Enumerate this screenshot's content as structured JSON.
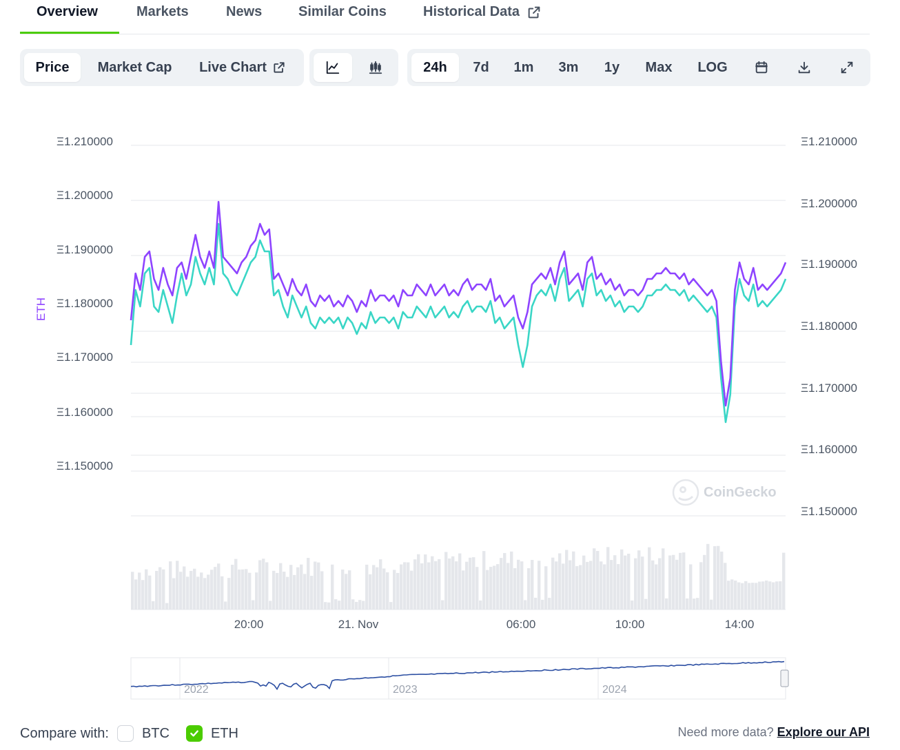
{
  "tabs": [
    {
      "label": "Overview",
      "active": true
    },
    {
      "label": "Markets"
    },
    {
      "label": "News"
    },
    {
      "label": "Similar Coins"
    },
    {
      "label": "Historical Data",
      "icon": "external-link-icon"
    }
  ],
  "view_group": {
    "price": "Price",
    "market_cap": "Market Cap",
    "live_chart": "Live Chart"
  },
  "chart_type_group": {
    "line": "line-chart-icon",
    "candle": "candlestick-icon"
  },
  "range_group": {
    "items": [
      "24h",
      "7d",
      "1m",
      "3m",
      "1y",
      "Max",
      "LOG"
    ],
    "selected": "24h"
  },
  "tool_icons": [
    "calendar-icon",
    "download-icon",
    "fullscreen-icon"
  ],
  "colors": {
    "eth_series": "#8e44ff",
    "btc_series": "#3ad6c6",
    "accent": "#4bcc00",
    "volume": "#e5e7eb"
  },
  "chart_data": {
    "type": "line",
    "ylabel": "ETH",
    "y_ticks_left": [
      "Ξ1.210000",
      "Ξ1.200000",
      "Ξ1.190000",
      "Ξ1.180000",
      "Ξ1.170000",
      "Ξ1.160000",
      "Ξ1.150000"
    ],
    "y_ticks_right": [
      "Ξ1.210000",
      "Ξ1.200000",
      "Ξ1.190000",
      "Ξ1.180000",
      "Ξ1.170000",
      "Ξ1.160000",
      "Ξ1.150000"
    ],
    "x_ticks": [
      "20:00",
      "21. Nov",
      "06:00",
      "10:00",
      "14:00"
    ],
    "navigator_ticks": [
      "2022",
      "2023",
      "2024"
    ],
    "watermark": "CoinGecko",
    "series": [
      {
        "values": [
          1.1775,
          1.186,
          1.183,
          1.189,
          1.19,
          1.185,
          1.183,
          1.187,
          1.184,
          1.182,
          1.187,
          1.188,
          1.185,
          1.189,
          1.193,
          1.189,
          1.187,
          1.19,
          1.187,
          1.199,
          1.189,
          1.188,
          1.187,
          1.186,
          1.188,
          1.189,
          1.191,
          1.192,
          1.195,
          1.193,
          1.194,
          1.185,
          1.186,
          1.184,
          1.182,
          1.185,
          1.183,
          1.182,
          1.184,
          1.181,
          1.18,
          1.182,
          1.181,
          1.182,
          1.18,
          1.181,
          1.18,
          1.182,
          1.181,
          1.179,
          1.181,
          1.18,
          1.183,
          1.181,
          1.182,
          1.182,
          1.181,
          1.182,
          1.18,
          1.183,
          1.182,
          1.182,
          1.184,
          1.183,
          1.182,
          1.184,
          1.182,
          1.183,
          1.184,
          1.182,
          1.183,
          1.182,
          1.184,
          1.185,
          1.183,
          1.184,
          1.184,
          1.183,
          1.185,
          1.181,
          1.182,
          1.18,
          1.181,
          1.182,
          1.178,
          1.176,
          1.179,
          1.184,
          1.185,
          1.186,
          1.185,
          1.187,
          1.184,
          1.188,
          1.19,
          1.184,
          1.185,
          1.186,
          1.183,
          1.188,
          1.189,
          1.185,
          1.186,
          1.184,
          1.185,
          1.183,
          1.184,
          1.182,
          1.183,
          1.183,
          1.182,
          1.183,
          1.185,
          1.185,
          1.186,
          1.186,
          1.187,
          1.186,
          1.186,
          1.185,
          1.186,
          1.184,
          1.185,
          1.184,
          1.183,
          1.182,
          1.183,
          1.181,
          1.17,
          1.162,
          1.167,
          1.183,
          1.188,
          1.185,
          1.184,
          1.187,
          1.183,
          1.184,
          1.183,
          1.184,
          1.185,
          1.186,
          1.188
        ]
      },
      {
        "values": [
          1.173,
          1.183,
          1.18,
          1.186,
          1.187,
          1.18,
          1.179,
          1.183,
          1.18,
          1.177,
          1.182,
          1.186,
          1.182,
          1.184,
          1.189,
          1.186,
          1.184,
          1.187,
          1.184,
          1.195,
          1.186,
          1.185,
          1.183,
          1.182,
          1.184,
          1.186,
          1.188,
          1.189,
          1.192,
          1.19,
          1.19,
          1.182,
          1.183,
          1.18,
          1.178,
          1.182,
          1.18,
          1.178,
          1.18,
          1.177,
          1.176,
          1.178,
          1.177,
          1.178,
          1.177,
          1.178,
          1.176,
          1.178,
          1.177,
          1.175,
          1.177,
          1.176,
          1.179,
          1.177,
          1.178,
          1.178,
          1.177,
          1.178,
          1.176,
          1.179,
          1.178,
          1.178,
          1.18,
          1.179,
          1.178,
          1.18,
          1.178,
          1.179,
          1.18,
          1.178,
          1.179,
          1.178,
          1.18,
          1.181,
          1.179,
          1.18,
          1.18,
          1.179,
          1.181,
          1.177,
          1.178,
          1.176,
          1.177,
          1.178,
          1.173,
          1.169,
          1.173,
          1.18,
          1.182,
          1.183,
          1.182,
          1.184,
          1.181,
          1.185,
          1.187,
          1.181,
          1.182,
          1.183,
          1.18,
          1.185,
          1.186,
          1.182,
          1.183,
          1.181,
          1.182,
          1.18,
          1.181,
          1.179,
          1.18,
          1.18,
          1.179,
          1.18,
          1.182,
          1.182,
          1.183,
          1.183,
          1.184,
          1.183,
          1.183,
          1.182,
          1.183,
          1.181,
          1.182,
          1.181,
          1.18,
          1.179,
          1.18,
          1.178,
          1.167,
          1.159,
          1.164,
          1.18,
          1.185,
          1.182,
          1.181,
          1.184,
          1.18,
          1.181,
          1.18,
          1.181,
          1.182,
          1.183,
          1.185
        ]
      }
    ]
  },
  "compare": {
    "label": "Compare with:",
    "btc": "BTC",
    "eth": "ETH"
  },
  "footer": {
    "need_more": "Need more data?",
    "api_link": "Explore our API"
  }
}
